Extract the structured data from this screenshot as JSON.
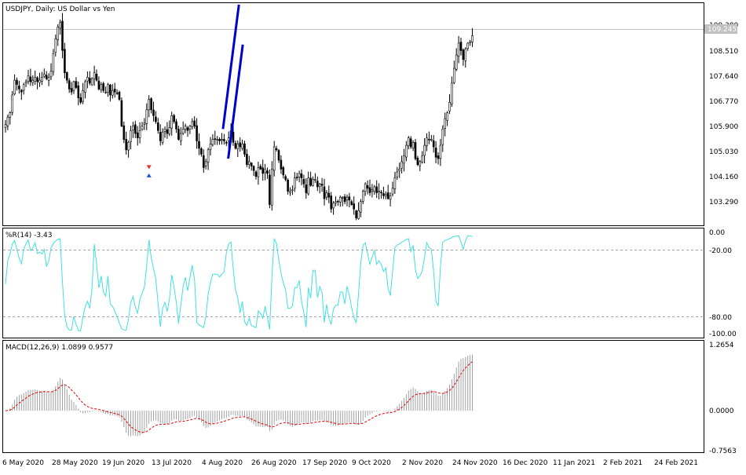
{
  "chart_data": [
    {
      "type": "candlestick",
      "title": "USDJPY, Daily:  US Dollar vs Yen",
      "price_label": "109.245",
      "current_price": 109.245,
      "ylim": [
        102.7,
        110.2
      ],
      "yticks": [
        "109.380",
        "108.510",
        "107.640",
        "106.770",
        "105.900",
        "105.030",
        "104.160",
        "103.290"
      ],
      "channel_lines": [
        {
          "from": [
            95.5,
            105.95
          ],
          "to": [
            102.5,
            110.15
          ]
        },
        {
          "from": [
            97.8,
            104.95
          ],
          "to": [
            104.2,
            108.8
          ]
        }
      ],
      "arrow_marks": [
        {
          "x": 63,
          "y": 104.65,
          "label": "sell"
        },
        {
          "x": 63,
          "y": 104.4,
          "label": "buy"
        }
      ],
      "colors": {
        "candle": "#000000",
        "channel": "#0000cc",
        "price_line": "#c0c0c0",
        "sell_arrow": "#e03020",
        "buy_arrow": "#2050d0"
      },
      "close": [
        106.1,
        106.35,
        106.5,
        107.1,
        107.6,
        107.45,
        107.3,
        107.2,
        107.45,
        107.55,
        107.75,
        107.55,
        107.6,
        107.7,
        107.55,
        107.6,
        107.7,
        107.8,
        107.65,
        107.7,
        107.9,
        108.5,
        109.0,
        109.4,
        109.55,
        108.6,
        107.85,
        107.6,
        107.3,
        107.2,
        107.55,
        107.35,
        107.0,
        106.85,
        107.25,
        107.55,
        107.7,
        107.5,
        107.65,
        107.85,
        107.6,
        107.3,
        107.45,
        107.25,
        107.2,
        107.45,
        107.1,
        107.25,
        107.2,
        107.15,
        106.95,
        106.05,
        105.6,
        105.25,
        105.5,
        105.9,
        106.05,
        105.8,
        105.65,
        105.9,
        106.05,
        106.15,
        106.6,
        106.95,
        106.6,
        106.4,
        106.2,
        105.9,
        105.55,
        105.85,
        105.95,
        105.8,
        106.0,
        106.4,
        106.2,
        105.95,
        105.6,
        105.8,
        105.95,
        106.05,
        105.9,
        106.05,
        106.2,
        106.05,
        105.55,
        105.3,
        105.1,
        104.65,
        104.85,
        105.25,
        105.45,
        105.6,
        105.6,
        105.6,
        105.55,
        105.6,
        105.55,
        105.5,
        105.65,
        105.9,
        105.5,
        105.3,
        105.45,
        105.35,
        105.45,
        105.1,
        104.75,
        104.85,
        104.7,
        104.55,
        104.35,
        104.65,
        104.6,
        104.45,
        104.6,
        104.45,
        103.4,
        104.6,
        105.35,
        105.25,
        104.9,
        104.6,
        104.4,
        104.25,
        103.85,
        103.85,
        103.9,
        104.3,
        104.3,
        104.45,
        104.3,
        104.1,
        103.8,
        104.3,
        104.05,
        104.25,
        104.25,
        104.0,
        104.1,
        104.05,
        103.6,
        103.8,
        103.65,
        103.25,
        103.45,
        103.5,
        103.5,
        103.65,
        103.65,
        103.5,
        103.65,
        103.55,
        103.4,
        103.25,
        102.95,
        103.2,
        103.5,
        103.85,
        104.1,
        103.95,
        103.8,
        103.9,
        104.0,
        103.8,
        103.85,
        103.8,
        103.7,
        103.75,
        103.6,
        103.7,
        103.95,
        104.3,
        104.5,
        104.6,
        104.85,
        105.05,
        105.4,
        105.65,
        105.35,
        105.5,
        104.95,
        104.75,
        104.85,
        105.05,
        105.4,
        105.65,
        105.6,
        105.6,
        105.35,
        105.0,
        104.95,
        105.4,
        105.95,
        106.3,
        106.5,
        106.85,
        107.5,
        108.0,
        108.45,
        108.85,
        108.6,
        108.3,
        108.65,
        108.85,
        108.9,
        109.1
      ]
    },
    {
      "type": "line",
      "title": "%R(14) -3.43",
      "ylim": [
        -100,
        0
      ],
      "yticks": [
        "0.00",
        "-20.00",
        "-80.00",
        "-100.00"
      ],
      "levels": [
        -20,
        -80
      ],
      "colors": {
        "line": "#40e0e0",
        "level": "#a0a0a0"
      }
    },
    {
      "type": "bar",
      "title": "MACD(12,26,9) 1.0899 0.9577",
      "ylim": [
        -0.7563,
        1.2654
      ],
      "yticks": [
        "1.2654",
        "0.0000",
        "-0.7563"
      ],
      "colors": {
        "histogram": "#a0a0a0",
        "signal": "#e00000"
      }
    }
  ],
  "x_axis": {
    "labels": [
      "6 May 2020",
      "28 May 2020",
      "19 Jun 2020",
      "13 Jul 2020",
      "4 Aug 2020",
      "26 Aug 2020",
      "17 Sep 2020",
      "9 Oct 2020",
      "2 Nov 2020",
      "24 Nov 2020",
      "16 Dec 2020",
      "11 Jan 2021",
      "2 Feb 2021",
      "24 Feb 2021"
    ]
  }
}
